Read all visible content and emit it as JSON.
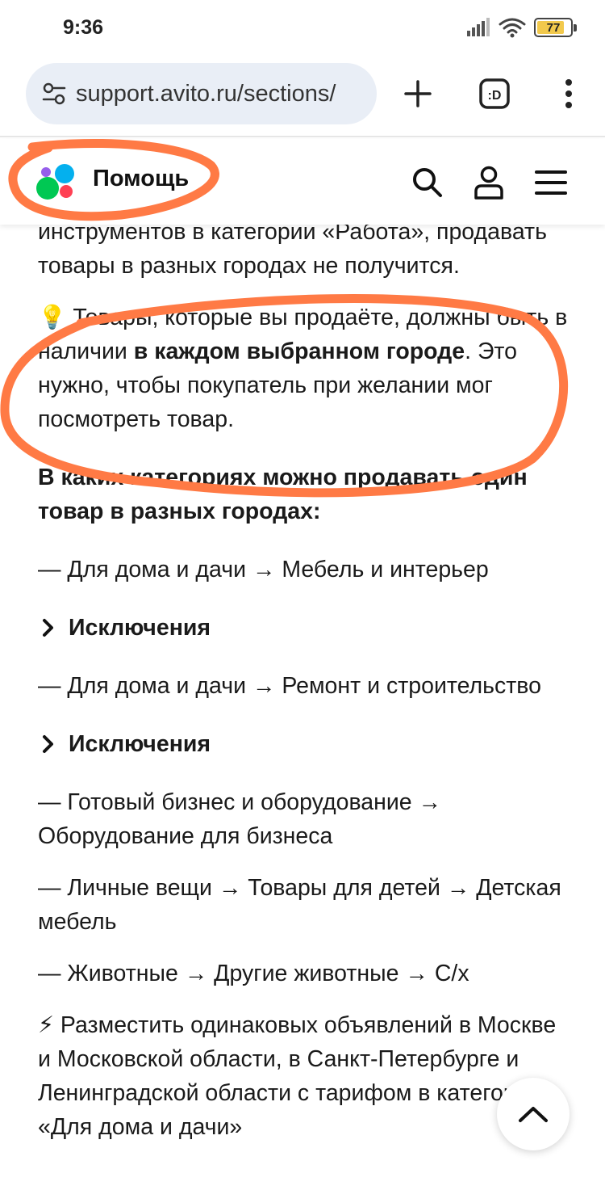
{
  "status_bar": {
    "time": "9:36",
    "battery_level": "77"
  },
  "browser": {
    "url": "support.avito.ru/sections/",
    "tab_count": ":D"
  },
  "header": {
    "title": "Помощь"
  },
  "article": {
    "intro": "инструментов в категории «Работа», продавать товары в разных городах не получится.",
    "tip_emoji": "💡",
    "tip_before": " Товары, которые вы продаёте, должны быть в наличии ",
    "tip_bold": "в каждом выбранном городе",
    "tip_after": ". Это нужно, чтобы покупатель при желании мог посмотреть товар.",
    "categories_heading": "В каких категориях можно продавать один товар в разных городах:",
    "item1": "— Для дома и дачи → Мебель и интерьер",
    "exceptions_label": "Исключения",
    "item2": "— Для дома и дачи → Ремонт и строительство",
    "item3": "— Готовый бизнес и оборудование → Оборудование для бизнеса",
    "item4": "— Личные вещи → Товары для детей → Детская мебель",
    "item5": "— Животные → Другие животные → С/х",
    "lightning_emoji": "⚡",
    "final_text": " Разместить одинаковых объявлений в Москве и Московской области, в Санкт-Петербурге и Ленинградской области с тарифом в категории «Для дома и дачи»"
  },
  "colors": {
    "annotation": "#ff7a45",
    "url_pill": "#e9eef6",
    "logo_purple": "#965eeb",
    "logo_blue": "#04b0ee",
    "logo_green": "#00c853",
    "logo_red": "#ff4053"
  }
}
